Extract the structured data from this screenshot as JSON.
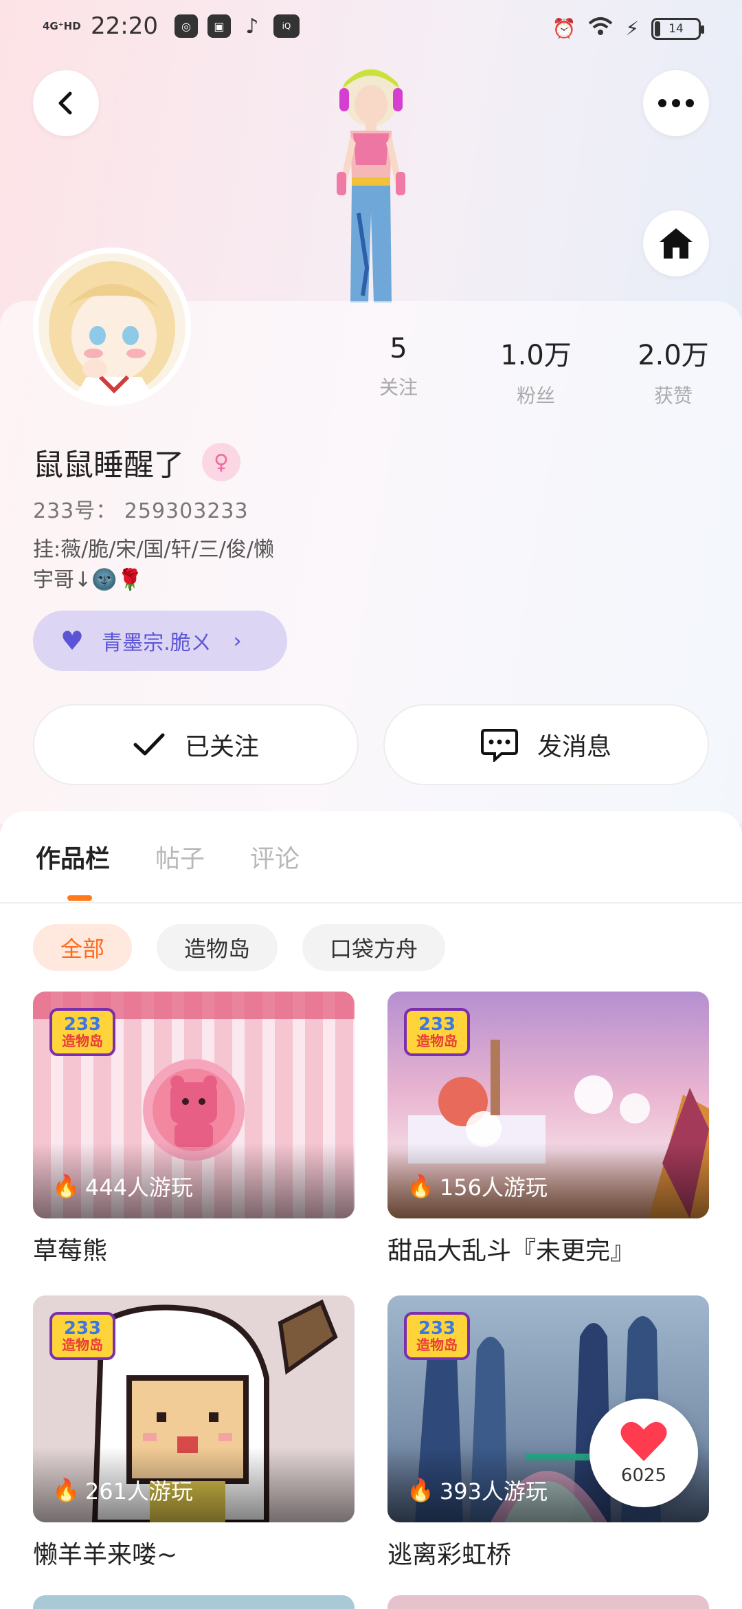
{
  "status_bar": {
    "network": "4G⁺HD",
    "time": "22:20",
    "battery": "14"
  },
  "profile": {
    "username": "鼠鼠睡醒了",
    "uid": "233号： 259303233",
    "bio": "挂:薇/脆/宋/国/轩/三/俊/懒\n宇哥↓🌚🌹",
    "group_name": "青墨宗.脆ㄨ",
    "stats": [
      {
        "value": "5",
        "label": "关注"
      },
      {
        "value": "1.0万",
        "label": "粉丝"
      },
      {
        "value": "2.0万",
        "label": "获赞"
      }
    ],
    "followed_label": "已关注",
    "message_label": "发消息"
  },
  "tabs": [
    {
      "label": "作品栏",
      "active": true
    },
    {
      "label": "帖子",
      "active": false
    },
    {
      "label": "评论",
      "active": false
    }
  ],
  "filters": [
    {
      "label": "全部",
      "active": true
    },
    {
      "label": "造物岛",
      "active": false
    },
    {
      "label": "口袋方舟",
      "active": false
    }
  ],
  "badge": {
    "line1": "233",
    "line2": "造物岛"
  },
  "works": [
    {
      "title": "草莓熊",
      "plays": "444人游玩"
    },
    {
      "title": "甜品大乱斗『未更完』",
      "plays": "156人游玩"
    },
    {
      "title": "懒羊羊来喽~",
      "plays": "261人游玩"
    },
    {
      "title": "逃离彩虹桥",
      "plays": "393人游玩"
    }
  ],
  "like_count": "6025",
  "colors": {
    "accent_orange": "#ff7a1a",
    "group_purple": "#5b55d6",
    "like_red": "#ff3b4f"
  }
}
